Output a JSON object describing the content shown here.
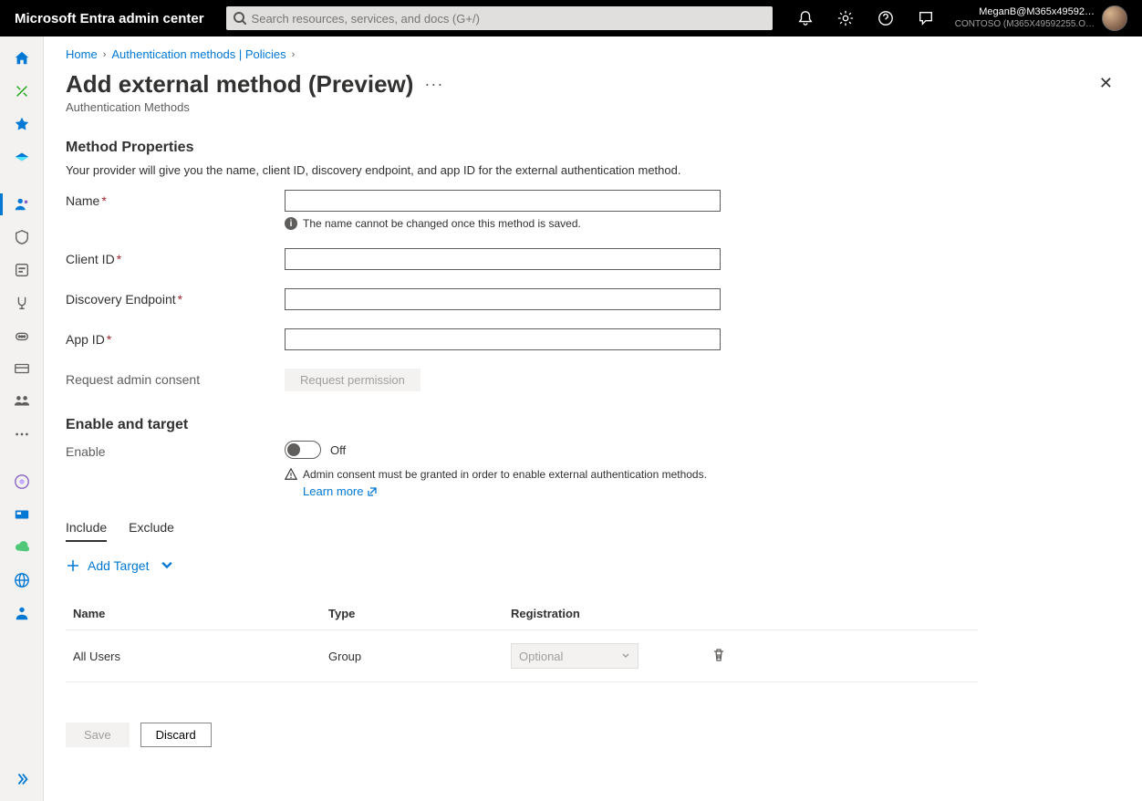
{
  "header": {
    "brand": "Microsoft Entra admin center",
    "search_placeholder": "Search resources, services, and docs (G+/)",
    "user": "MeganB@M365x49592…",
    "tenant": "CONTOSO (M365X49592255.O…"
  },
  "breadcrumb": {
    "items": [
      "Home",
      "Authentication methods | Policies"
    ]
  },
  "page": {
    "title": "Add external method (Preview)",
    "subtitle": "Authentication Methods"
  },
  "properties": {
    "heading": "Method Properties",
    "description": "Your provider will give you the name, client ID, discovery endpoint, and app ID for the external authentication method.",
    "name_label": "Name",
    "name_value": "",
    "name_hint": "The name cannot be changed once this method is saved.",
    "clientid_label": "Client ID",
    "clientid_value": "",
    "discovery_label": "Discovery Endpoint",
    "discovery_value": "",
    "appid_label": "App ID",
    "appid_value": "",
    "consent_label": "Request admin consent",
    "consent_button": "Request permission"
  },
  "enable": {
    "heading": "Enable and target",
    "enable_label": "Enable",
    "toggle_state": "Off",
    "warning": "Admin consent must be granted in order to enable external authentication methods.",
    "learn_more": "Learn more"
  },
  "tabs": {
    "include": "Include",
    "exclude": "Exclude"
  },
  "add_target": "Add Target",
  "table": {
    "col_name": "Name",
    "col_type": "Type",
    "col_registration": "Registration",
    "rows": [
      {
        "name": "All Users",
        "type": "Group",
        "registration": "Optional"
      }
    ]
  },
  "footer": {
    "save": "Save",
    "discard": "Discard"
  }
}
